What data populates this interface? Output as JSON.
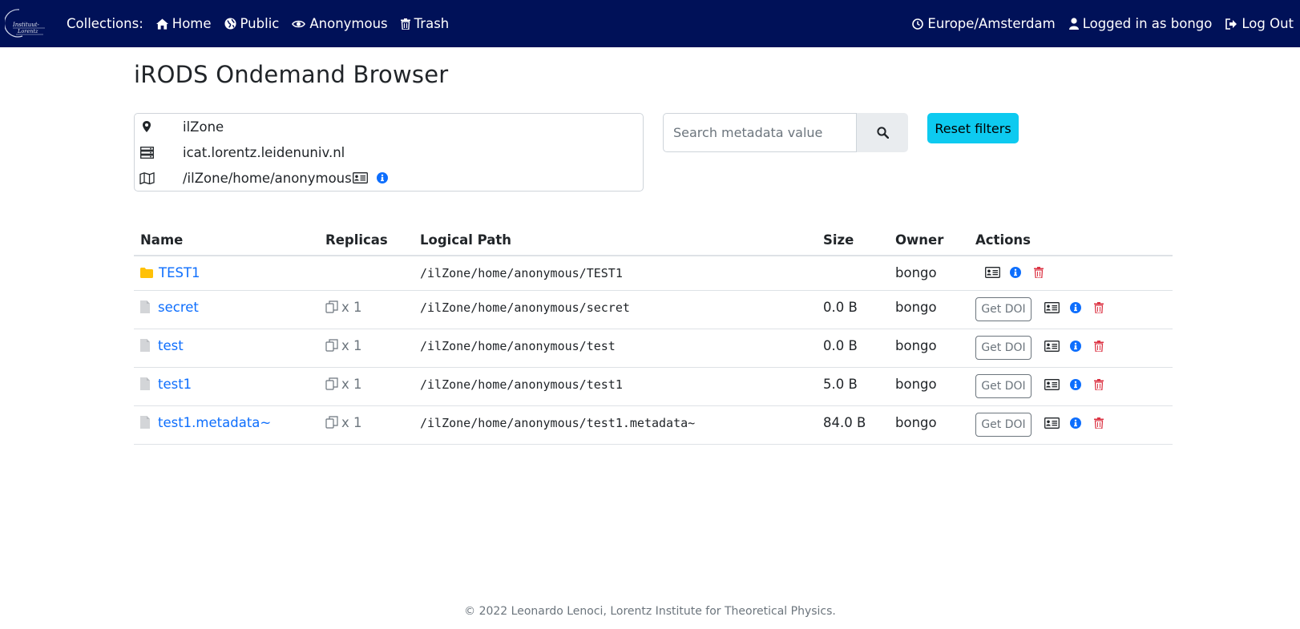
{
  "navbar": {
    "logo_alt": "Instituut-Lorentz",
    "collections_label": "Collections:",
    "links": [
      {
        "label": "Home",
        "icon": "home-icon"
      },
      {
        "label": "Public",
        "icon": "globe-icon"
      },
      {
        "label": "Anonymous",
        "icon": "eye-icon"
      },
      {
        "label": "Trash",
        "icon": "trash-icon"
      }
    ],
    "timezone": "Europe/Amsterdam",
    "user": "Logged in as bongo",
    "logout": "Log Out"
  },
  "page": {
    "title": "iRODS Ondemand Browser"
  },
  "info": {
    "zone": "ilZone",
    "host": "icat.lorentz.leidenuniv.nl",
    "path": "/ilZone/home/anonymous"
  },
  "search": {
    "placeholder": "Search metadata value",
    "reset_label": "Reset filters"
  },
  "table": {
    "headers": [
      "Name",
      "Replicas",
      "Logical Path",
      "Size",
      "Owner",
      "Actions"
    ],
    "rows": [
      {
        "name": "TEST1",
        "type": "collection",
        "replicas": "",
        "path": "/ilZone/home/anonymous/TEST1",
        "size": "",
        "owner": "bongo"
      },
      {
        "name": "secret",
        "type": "file",
        "replicas": "x 1",
        "path": "/ilZone/home/anonymous/secret",
        "size": "0.0 B",
        "owner": "bongo",
        "doi_label": "Get DOI"
      },
      {
        "name": "test",
        "type": "file",
        "replicas": "x 1",
        "path": "/ilZone/home/anonymous/test",
        "size": "0.0 B",
        "owner": "bongo",
        "doi_label": "Get DOI"
      },
      {
        "name": "test1",
        "type": "file",
        "replicas": "x 1",
        "path": "/ilZone/home/anonymous/test1",
        "size": "5.0 B",
        "owner": "bongo",
        "doi_label": "Get DOI"
      },
      {
        "name": "test1.metadata~",
        "type": "file",
        "replicas": "x 1",
        "path": "/ilZone/home/anonymous/test1.metadata~",
        "size": "84.0 B",
        "owner": "bongo",
        "doi_label": "Get DOI"
      }
    ]
  },
  "footer": {
    "text": "© 2022 Leonardo Lenoci, Lorentz Institute for Theoretical Physics."
  },
  "colors": {
    "navbar": "#001158",
    "link": "#0d6efd",
    "danger": "#dc3545",
    "folder": "#ffc107",
    "reset": "#0dcaf0"
  }
}
